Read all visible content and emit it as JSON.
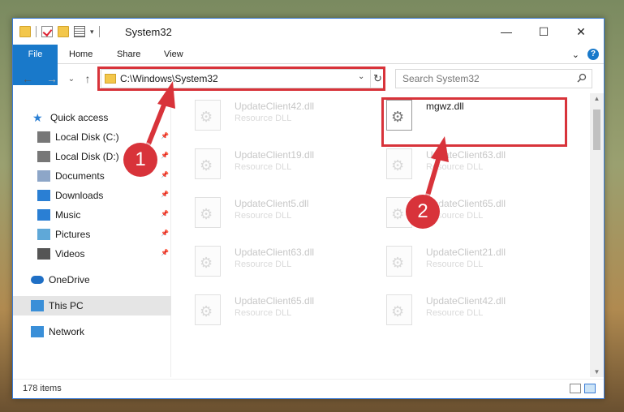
{
  "window": {
    "title": "System32",
    "controls": {
      "minimize": "—",
      "maximize": "☐",
      "close": "✕"
    }
  },
  "ribbon": {
    "tabs": [
      "File",
      "Home",
      "Share",
      "View"
    ],
    "collapse": "⌄",
    "help": "?"
  },
  "nav": {
    "back": "←",
    "forward": "→",
    "recent": "⌄",
    "up": "↑",
    "address": "C:\\Windows\\System32",
    "address_dropdown": "⌄",
    "refresh": "↻",
    "search_placeholder": "Search System32"
  },
  "sidebar": {
    "items": [
      {
        "label": "Quick access",
        "icon": "star-icon",
        "pinned": false
      },
      {
        "label": "Local Disk (C:)",
        "icon": "drive-icon",
        "pinned": true
      },
      {
        "label": "Local Disk (D:)",
        "icon": "drive-icon",
        "pinned": true
      },
      {
        "label": "Documents",
        "icon": "documents-icon",
        "pinned": true
      },
      {
        "label": "Downloads",
        "icon": "downloads-icon",
        "pinned": true
      },
      {
        "label": "Music",
        "icon": "music-icon",
        "pinned": true
      },
      {
        "label": "Pictures",
        "icon": "pictures-icon",
        "pinned": true
      },
      {
        "label": "Videos",
        "icon": "videos-icon",
        "pinned": true
      },
      {
        "label": "OneDrive",
        "icon": "cloud-icon",
        "pinned": false
      },
      {
        "label": "This PC",
        "icon": "computer-icon",
        "pinned": false
      },
      {
        "label": "Network",
        "icon": "network-icon",
        "pinned": false
      }
    ],
    "selected": "This PC"
  },
  "files": [
    {
      "name": "UpdateClient42.dll",
      "type": "Resource DLL"
    },
    {
      "name": "mgwz.dll",
      "type": ""
    },
    {
      "name": "UpdateClient19.dll",
      "type": "Resource DLL"
    },
    {
      "name": "UpdateClient63.dll",
      "type": "Resource DLL"
    },
    {
      "name": "UpdateClient5.dll",
      "type": "Resource DLL"
    },
    {
      "name": "UpdateClient65.dll",
      "type": "Resource DLL"
    },
    {
      "name": "UpdateClient63.dll",
      "type": "Resource DLL"
    },
    {
      "name": "UpdateClient21.dll",
      "type": "Resource DLL"
    },
    {
      "name": "UpdateClient65.dll",
      "type": "Resource DLL"
    },
    {
      "name": "UpdateClient42.dll",
      "type": "Resource DLL"
    }
  ],
  "status": {
    "item_count": "178 items"
  },
  "annotations": {
    "step1": "1",
    "step2": "2",
    "color": "#d8333a"
  }
}
